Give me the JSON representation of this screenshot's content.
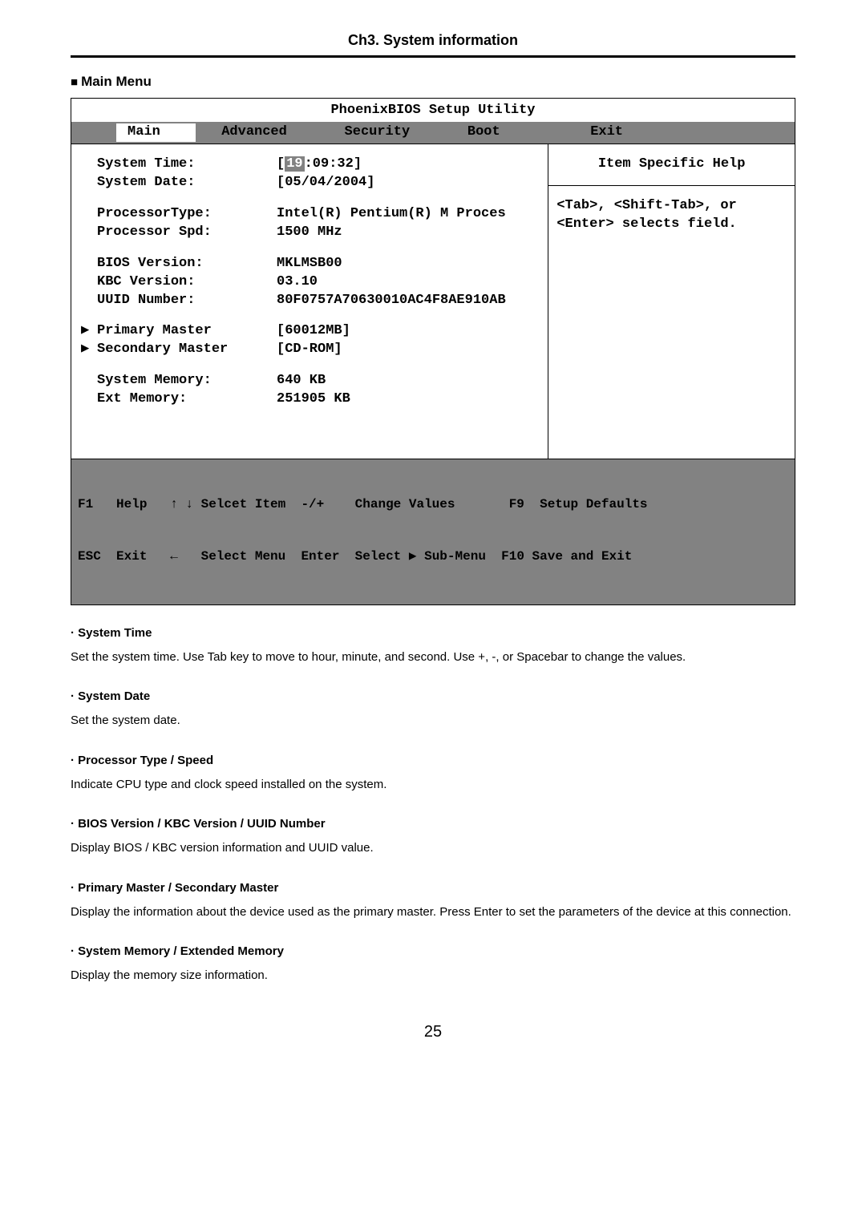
{
  "chapter_title": "Ch3. System information",
  "menu_heading": "Main Menu",
  "bios": {
    "title": "PhoenixBIOS Setup Utility",
    "tabs": {
      "main": "Main",
      "advanced": "Advanced",
      "security": "Security",
      "boot": "Boot",
      "exit": "Exit"
    },
    "rows": {
      "time_lbl": "System Time:",
      "time_hh": "19",
      "time_rest": ":09:32]",
      "date_lbl": "System Date:",
      "date_val": "[05/04/2004]",
      "ptype_lbl": "ProcessorType:",
      "ptype_val": "Intel(R) Pentium(R) M Proces",
      "pspd_lbl": "Processor Spd:",
      "pspd_val": "1500 MHz",
      "bver_lbl": "BIOS Version:",
      "bver_val": "MKLMSB00",
      "kbc_lbl": "KBC Version:",
      "kbc_val": "03.10",
      "uuid_lbl": "UUID Number:",
      "uuid_val": "80F0757A70630010AC4F8AE910AB",
      "pm_lbl": "Primary Master",
      "pm_val": "[60012MB]",
      "sm_lbl": "Secondary Master",
      "sm_val": "[CD-ROM]",
      "sysmem_lbl": "System Memory:",
      "sysmem_val": "640 KB",
      "extmem_lbl": "Ext Memory:",
      "extmem_val": "251905 KB"
    },
    "help": {
      "title": "Item Specific Help",
      "line1": "<Tab>, <Shift-Tab>, or",
      "line2": "<Enter> selects field."
    },
    "footer": {
      "l1": "F1   Help   ↑ ↓ Selcet Item  -/+    Change Values       F9  Setup Defaults",
      "l2": "ESC  Exit   ←   Select Menu  Enter  Select ▶ Sub-Menu  F10 Save and Exit"
    }
  },
  "sections": {
    "s1_t": "· System Time",
    "s1_b": "Set the system time. Use Tab key to move to hour, minute, and second. Use +, -, or Spacebar to change the values.",
    "s2_t": "· System Date",
    "s2_b": "Set the system date.",
    "s3_t": "· Processor Type / Speed",
    "s3_b": "Indicate CPU type  and clock speed installed on the system.",
    "s4_t": "· BIOS Version / KBC Version / UUID Number",
    "s4_b": "Display BIOS / KBC version information and  UUID value.",
    "s5_t": "· Primary Master / Secondary Master",
    "s5_b": "Display the information about the device used as the primary master. Press Enter to set the parameters of the device at this connection.",
    "s6_t": "· System Memory / Extended Memory",
    "s6_b": "Display the memory size information."
  },
  "page_number": "25"
}
